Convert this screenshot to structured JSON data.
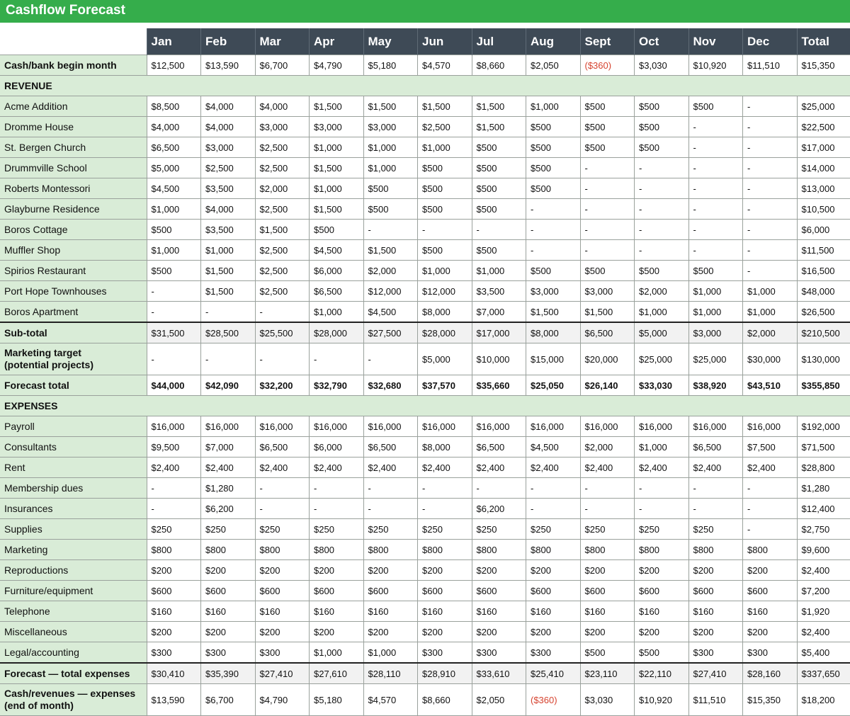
{
  "title": "Cashflow Forecast",
  "columns": [
    "Jan",
    "Feb",
    "Mar",
    "Apr",
    "May",
    "Jun",
    "Jul",
    "Aug",
    "Sept",
    "Oct",
    "Nov",
    "Dec",
    "Total"
  ],
  "colors": {
    "title_bg": "#35ad4b",
    "header_bg": "#3e4a56",
    "label_bg": "#d9ecd7",
    "negative": "#d6432f"
  },
  "rows": [
    {
      "label": "Cash/bank begin month",
      "type": "bold-label",
      "values": [
        "$12,500",
        "$13,590",
        "$6,700",
        "$4,790",
        "$5,180",
        "$4,570",
        "$8,660",
        "$2,050",
        "($360)",
        "$3,030",
        "$10,920",
        "$11,510",
        "$15,350"
      ]
    },
    {
      "label": "REVENUE",
      "type": "section"
    },
    {
      "label": "Acme Addition",
      "values": [
        "$8,500",
        "$4,000",
        "$4,000",
        "$1,500",
        "$1,500",
        "$1,500",
        "$1,500",
        "$1,000",
        "$500",
        "$500",
        "$500",
        "-",
        "$25,000"
      ]
    },
    {
      "label": "Dromme House",
      "values": [
        "$4,000",
        "$4,000",
        "$3,000",
        "$3,000",
        "$3,000",
        "$2,500",
        "$1,500",
        "$500",
        "$500",
        "$500",
        "-",
        "-",
        "$22,500"
      ]
    },
    {
      "label": "St. Bergen Church",
      "values": [
        "$6,500",
        "$3,000",
        "$2,500",
        "$1,000",
        "$1,000",
        "$1,000",
        "$500",
        "$500",
        "$500",
        "$500",
        "-",
        "-",
        "$17,000"
      ]
    },
    {
      "label": "Drummville School",
      "values": [
        "$5,000",
        "$2,500",
        "$2,500",
        "$1,500",
        "$1,000",
        "$500",
        "$500",
        "$500",
        "-",
        "-",
        "-",
        "-",
        "$14,000"
      ]
    },
    {
      "label": "Roberts Montessori",
      "values": [
        "$4,500",
        "$3,500",
        "$2,000",
        "$1,000",
        "$500",
        "$500",
        "$500",
        "$500",
        "-",
        "-",
        "-",
        "-",
        "$13,000"
      ]
    },
    {
      "label": "Glayburne Residence",
      "values": [
        "$1,000",
        "$4,000",
        "$2,500",
        "$1,500",
        "$500",
        "$500",
        "$500",
        "-",
        "-",
        "-",
        "-",
        "-",
        "$10,500"
      ]
    },
    {
      "label": "Boros Cottage",
      "values": [
        "$500",
        "$3,500",
        "$1,500",
        "$500",
        "-",
        "-",
        "-",
        "-",
        "-",
        "-",
        "-",
        "-",
        "$6,000"
      ]
    },
    {
      "label": "Muffler Shop",
      "values": [
        "$1,000",
        "$1,000",
        "$2,500",
        "$4,500",
        "$1,500",
        "$500",
        "$500",
        "-",
        "-",
        "-",
        "-",
        "-",
        "$11,500"
      ]
    },
    {
      "label": "Spirios Restaurant",
      "values": [
        "$500",
        "$1,500",
        "$2,500",
        "$6,000",
        "$2,000",
        "$1,000",
        "$1,000",
        "$500",
        "$500",
        "$500",
        "$500",
        "-",
        "$16,500"
      ]
    },
    {
      "label": "Port Hope Townhouses",
      "values": [
        "-",
        "$1,500",
        "$2,500",
        "$6,500",
        "$12,000",
        "$12,000",
        "$3,500",
        "$3,000",
        "$3,000",
        "$2,000",
        "$1,000",
        "$1,000",
        "$48,000"
      ]
    },
    {
      "label": "Boros Apartment",
      "values": [
        "-",
        "-",
        "-",
        "$1,000",
        "$4,500",
        "$8,000",
        "$7,000",
        "$1,500",
        "$1,500",
        "$1,000",
        "$1,000",
        "$1,000",
        "$26,500"
      ]
    },
    {
      "label": "Sub-total",
      "type": "subtotal",
      "values": [
        "$31,500",
        "$28,500",
        "$25,500",
        "$28,000",
        "$27,500",
        "$28,000",
        "$17,000",
        "$8,000",
        "$6,500",
        "$5,000",
        "$3,000",
        "$2,000",
        "$210,500"
      ]
    },
    {
      "label": "Marketing target",
      "label2": "(potential projects)",
      "type": "tall-bold-label",
      "values": [
        "-",
        "-",
        "-",
        "-",
        "-",
        "$5,000",
        "$10,000",
        "$15,000",
        "$20,000",
        "$25,000",
        "$25,000",
        "$30,000",
        "$130,000"
      ]
    },
    {
      "label": "Forecast total",
      "type": "bold-row",
      "values": [
        "$44,000",
        "$42,090",
        "$32,200",
        "$32,790",
        "$32,680",
        "$37,570",
        "$35,660",
        "$25,050",
        "$26,140",
        "$33,030",
        "$38,920",
        "$43,510",
        "$355,850"
      ]
    },
    {
      "label": "EXPENSES",
      "type": "section"
    },
    {
      "label": "Payroll",
      "values": [
        "$16,000",
        "$16,000",
        "$16,000",
        "$16,000",
        "$16,000",
        "$16,000",
        "$16,000",
        "$16,000",
        "$16,000",
        "$16,000",
        "$16,000",
        "$16,000",
        "$192,000"
      ]
    },
    {
      "label": "Consultants",
      "values": [
        "$9,500",
        "$7,000",
        "$6,500",
        "$6,000",
        "$6,500",
        "$8,000",
        "$6,500",
        "$4,500",
        "$2,000",
        "$1,000",
        "$6,500",
        "$7,500",
        "$71,500"
      ]
    },
    {
      "label": "Rent",
      "values": [
        "$2,400",
        "$2,400",
        "$2,400",
        "$2,400",
        "$2,400",
        "$2,400",
        "$2,400",
        "$2,400",
        "$2,400",
        "$2,400",
        "$2,400",
        "$2,400",
        "$28,800"
      ]
    },
    {
      "label": "Membership dues",
      "values": [
        "-",
        "$1,280",
        "-",
        "-",
        "-",
        "-",
        "-",
        "-",
        "-",
        "-",
        "-",
        "-",
        "$1,280"
      ]
    },
    {
      "label": "Insurances",
      "values": [
        "-",
        "$6,200",
        "-",
        "-",
        "-",
        "-",
        "$6,200",
        "-",
        "-",
        "-",
        "-",
        "-",
        "$12,400"
      ]
    },
    {
      "label": "Supplies",
      "values": [
        "$250",
        "$250",
        "$250",
        "$250",
        "$250",
        "$250",
        "$250",
        "$250",
        "$250",
        "$250",
        "$250",
        "-",
        "$2,750"
      ]
    },
    {
      "label": "Marketing",
      "values": [
        "$800",
        "$800",
        "$800",
        "$800",
        "$800",
        "$800",
        "$800",
        "$800",
        "$800",
        "$800",
        "$800",
        "$800",
        "$9,600"
      ]
    },
    {
      "label": "Reproductions",
      "values": [
        "$200",
        "$200",
        "$200",
        "$200",
        "$200",
        "$200",
        "$200",
        "$200",
        "$200",
        "$200",
        "$200",
        "$200",
        "$2,400"
      ]
    },
    {
      "label": "Furniture/equipment",
      "values": [
        "$600",
        "$600",
        "$600",
        "$600",
        "$600",
        "$600",
        "$600",
        "$600",
        "$600",
        "$600",
        "$600",
        "$600",
        "$7,200"
      ]
    },
    {
      "label": "Telephone",
      "values": [
        "$160",
        "$160",
        "$160",
        "$160",
        "$160",
        "$160",
        "$160",
        "$160",
        "$160",
        "$160",
        "$160",
        "$160",
        "$1,920"
      ]
    },
    {
      "label": "Miscellaneous",
      "values": [
        "$200",
        "$200",
        "$200",
        "$200",
        "$200",
        "$200",
        "$200",
        "$200",
        "$200",
        "$200",
        "$200",
        "$200",
        "$2,400"
      ]
    },
    {
      "label": "Legal/accounting",
      "values": [
        "$300",
        "$300",
        "$300",
        "$1,000",
        "$1,000",
        "$300",
        "$300",
        "$300",
        "$500",
        "$500",
        "$300",
        "$300",
        "$5,400"
      ]
    },
    {
      "label": "Forecast — total expenses",
      "type": "subtotal",
      "values": [
        "$30,410",
        "$35,390",
        "$27,410",
        "$27,610",
        "$28,110",
        "$28,910",
        "$33,610",
        "$25,410",
        "$23,110",
        "$22,110",
        "$27,410",
        "$28,160",
        "$337,650"
      ]
    },
    {
      "label": "Cash/revenues — expenses",
      "label2": "(end of month)",
      "type": "tall-bold-label",
      "values": [
        "$13,590",
        "$6,700",
        "$4,790",
        "$5,180",
        "$4,570",
        "$8,660",
        "$2,050",
        "($360)",
        "$3,030",
        "$10,920",
        "$11,510",
        "$15,350",
        "$18,200"
      ]
    }
  ]
}
